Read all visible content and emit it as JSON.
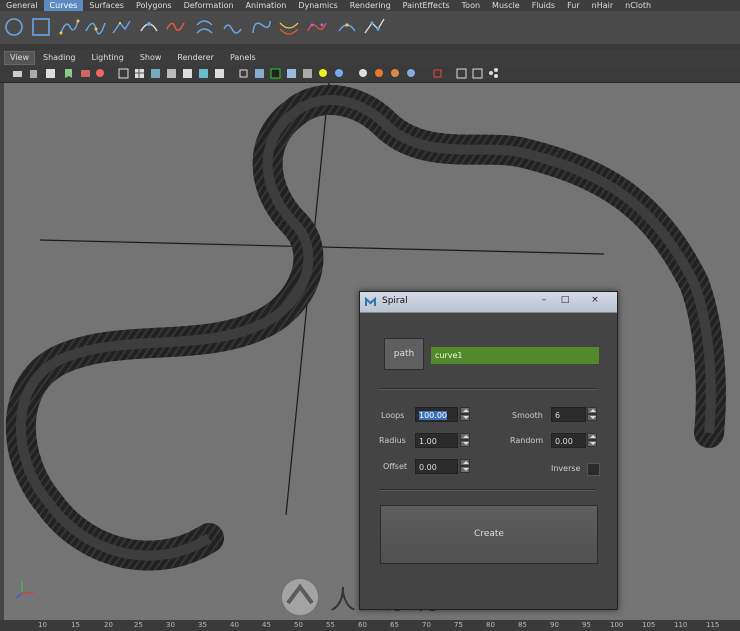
{
  "shelf_tabs": [
    "General",
    "Curves",
    "Surfaces",
    "Polygons",
    "Deformation",
    "Animation",
    "Dynamics",
    "Rendering",
    "PaintEffects",
    "Toon",
    "Muscle",
    "Fluids",
    "Fur",
    "nHair",
    "nCloth"
  ],
  "active_shelf_tab": "Curves",
  "panel_menu": [
    "View",
    "Shading",
    "Lighting",
    "Show",
    "Renderer",
    "Panels"
  ],
  "ruler_ticks": [
    "10",
    "15",
    "20",
    "25",
    "30",
    "35",
    "40",
    "45",
    "50",
    "55",
    "60",
    "65",
    "70",
    "75",
    "80",
    "85",
    "90",
    "95",
    "100",
    "105",
    "110",
    "115"
  ],
  "dialog": {
    "title": "Spiral",
    "minimize_glyph": "–",
    "maximize_glyph": "□",
    "close_glyph": "×",
    "path_label": "path",
    "path_value": "curve1",
    "loops_label": "Loops",
    "loops_value": "100.00",
    "smooth_label": "Smooth",
    "smooth_value": "6",
    "radius_label": "Radius",
    "radius_value": "1.00",
    "random_label": "Random",
    "random_value": "0.00",
    "offset_label": "Offset",
    "offset_value": "0.00",
    "inverse_label": "Inverse",
    "inverse_checked": false,
    "create_label": "Create"
  },
  "watermark_text": "人人素材",
  "colors": {
    "accent_tab": "#5b8bbf",
    "path_field": "#54892b",
    "viewport_bg": "#747474"
  }
}
